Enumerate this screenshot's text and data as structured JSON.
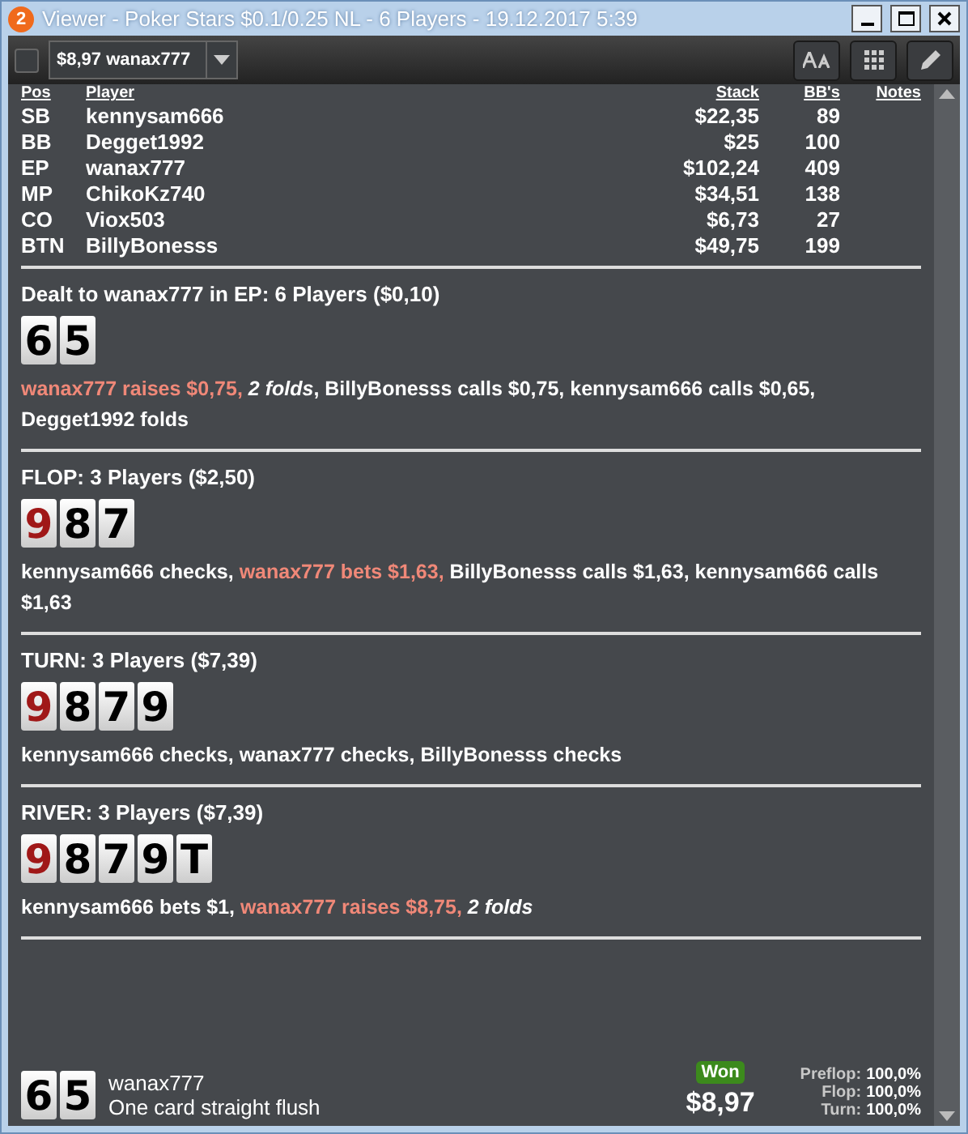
{
  "window": {
    "title": "Viewer - Poker Stars $0.1/0.25 NL - 6 Players - 19.12.2017 5:39",
    "badge": "2"
  },
  "toolbar": {
    "checked": false,
    "hand_select": "$8,97 wanax777"
  },
  "players": {
    "columns": [
      "Pos",
      "Player",
      "Stack",
      "BB's",
      "Notes"
    ],
    "rows": [
      {
        "pos": "SB",
        "player": "kennysam666",
        "stack": "$22,35",
        "bbs": "89"
      },
      {
        "pos": "BB",
        "player": "Degget1992",
        "stack": "$25",
        "bbs": "100"
      },
      {
        "pos": "EP",
        "player": "wanax777",
        "stack": "$102,24",
        "bbs": "409"
      },
      {
        "pos": "MP",
        "player": "ChikoKz740",
        "stack": "$34,51",
        "bbs": "138"
      },
      {
        "pos": "CO",
        "player": "Viox503",
        "stack": "$6,73",
        "bbs": "27"
      },
      {
        "pos": "BTN",
        "player": "BillyBonesss",
        "stack": "$49,75",
        "bbs": "199"
      }
    ]
  },
  "streets": [
    {
      "header": "Dealt to wanax777 in EP: 6 Players ($0,10)",
      "cards": [
        {
          "rank": "6",
          "color": "#000000"
        },
        {
          "rank": "5",
          "color": "#000000"
        }
      ],
      "actions": [
        {
          "kind": "hero",
          "text": "wanax777 raises $0,75,"
        },
        {
          "kind": "fold",
          "text": "2 folds"
        },
        {
          "kind": "plain",
          "text": ", BillyBonesss calls $0,75, kennysam666 calls $0,65, Degget1992 folds"
        }
      ]
    },
    {
      "header": "FLOP: 3 Players ($2,50)",
      "cards": [
        {
          "rank": "9",
          "color": "#a01818"
        },
        {
          "rank": "8",
          "color": "#000000"
        },
        {
          "rank": "7",
          "color": "#000000"
        }
      ],
      "actions": [
        {
          "kind": "plain",
          "text": "kennysam666 checks,"
        },
        {
          "kind": "hero",
          "text": "wanax777 bets $1,63,"
        },
        {
          "kind": "plain",
          "text": "BillyBonesss calls $1,63, kennysam666 calls $1,63"
        }
      ]
    },
    {
      "header": "TURN: 3 Players ($7,39)",
      "cards": [
        {
          "rank": "9",
          "color": "#a01818"
        },
        {
          "rank": "8",
          "color": "#000000"
        },
        {
          "rank": "7",
          "color": "#000000"
        },
        {
          "rank": "9",
          "color": "#000000"
        }
      ],
      "actions": [
        {
          "kind": "plain",
          "text": "kennysam666 checks, wanax777 checks, BillyBonesss checks"
        }
      ]
    },
    {
      "header": "RIVER: 3 Players ($7,39)",
      "cards": [
        {
          "rank": "9",
          "color": "#a01818"
        },
        {
          "rank": "8",
          "color": "#000000"
        },
        {
          "rank": "7",
          "color": "#000000"
        },
        {
          "rank": "9",
          "color": "#000000"
        },
        {
          "rank": "T",
          "color": "#000000"
        }
      ],
      "actions": [
        {
          "kind": "plain",
          "text": "kennysam666 bets $1,"
        },
        {
          "kind": "hero",
          "text": "wanax777 raises $8,75,"
        },
        {
          "kind": "fold",
          "text": "2 folds"
        }
      ]
    }
  ],
  "showdown": {
    "cards": [
      {
        "rank": "6",
        "color": "#000000"
      },
      {
        "rank": "5",
        "color": "#000000"
      }
    ],
    "player": "wanax777",
    "hand": "One card straight flush",
    "result": "Won",
    "amount": "$8,97",
    "equity": [
      {
        "label": "Preflop:",
        "value": "100,0%"
      },
      {
        "label": "Flop:",
        "value": "100,0%"
      },
      {
        "label": "Turn:",
        "value": "100,0%"
      }
    ]
  }
}
